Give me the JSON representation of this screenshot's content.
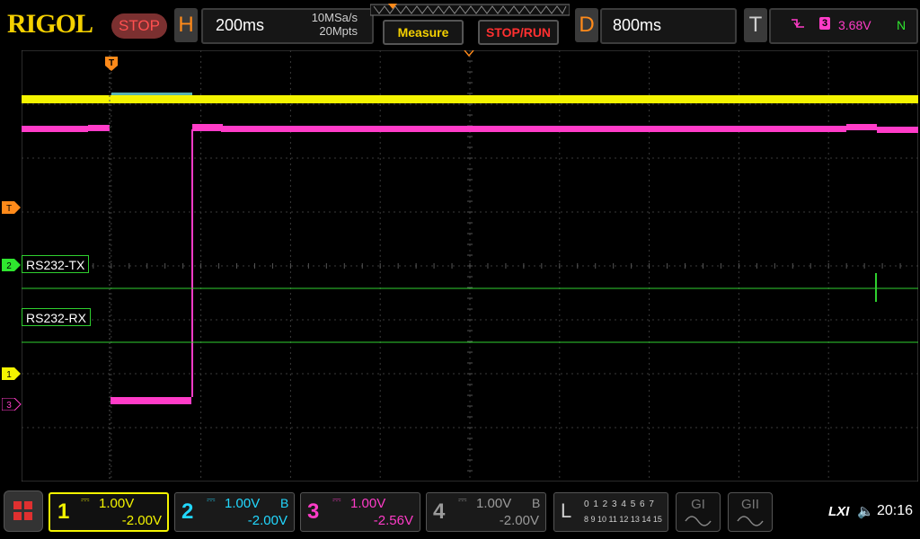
{
  "brand": {
    "logo_text": "RIGOL"
  },
  "run_state": {
    "label": "STOP"
  },
  "horizontal": {
    "key": "H",
    "timebase": "200ms",
    "sample_rate": "10MSa/s",
    "memory_depth": "20Mpts"
  },
  "buttons": {
    "measure": "Measure",
    "stop_run": "STOP/RUN"
  },
  "delay": {
    "key": "D",
    "value": "800ms"
  },
  "trigger": {
    "key": "T",
    "source": "3",
    "level": "3.68V",
    "mode": "N",
    "marker": "T"
  },
  "markers": {
    "ch1": "1",
    "ch2": "2",
    "ch3": "3",
    "trigger_side": "T"
  },
  "decode": {
    "bus1_label": "RS232-TX",
    "bus2_label": "RS232-RX"
  },
  "channels": [
    {
      "num": "1",
      "scale": "1.00V",
      "offset": "-2.00V",
      "bw": "",
      "color": "#f4f400"
    },
    {
      "num": "2",
      "scale": "1.00V",
      "offset": "-2.00V",
      "bw": "B",
      "color": "#22d8ff"
    },
    {
      "num": "3",
      "scale": "1.00V",
      "offset": "-2.56V",
      "bw": "",
      "color": "#ff3cc8"
    },
    {
      "num": "4",
      "scale": "1.00V",
      "offset": "-2.00V",
      "bw": "B",
      "color": "#9a9a9a"
    }
  ],
  "logic": {
    "key": "L",
    "row1": "0 1 2 3  4 5 6 7",
    "row2": "8 9 10 11 12 13 14 15"
  },
  "generators": {
    "g1": "GI",
    "g2": "GII"
  },
  "status": {
    "lxi": "LXI",
    "speaker": "🔈",
    "time": "20:16"
  },
  "colors": {
    "ch1": "#f4f400",
    "ch2": "#22d8ff",
    "ch3": "#ff3cc8",
    "ch4": "#9a9a9a",
    "decode": "#2fcf2f",
    "orange": "#ff8a1a"
  }
}
